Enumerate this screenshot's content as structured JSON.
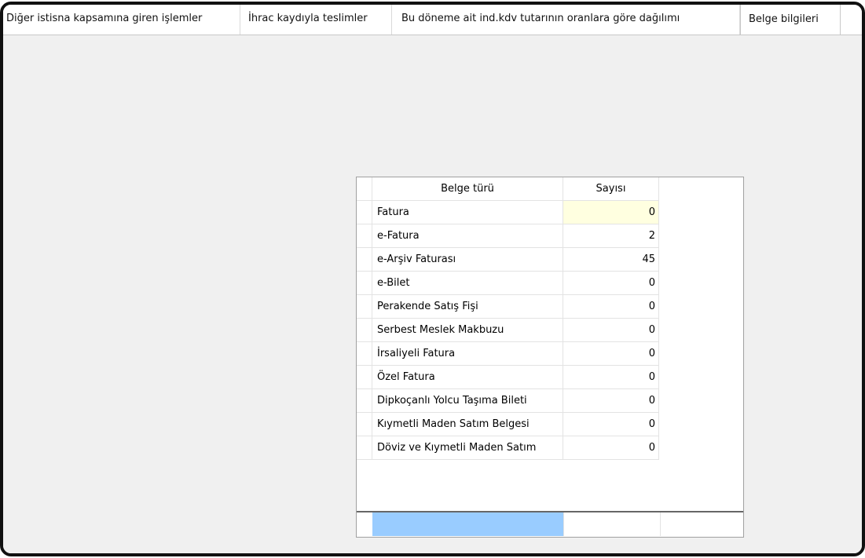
{
  "tabs": [
    {
      "label": "Diğer istisna kapsamına giren işlemler",
      "active": false
    },
    {
      "label": "İhrac kaydıyla teslimler",
      "active": false
    },
    {
      "label": "Bu döneme ait ind.kdv tutarının oranlara göre dağılımı",
      "active": false
    },
    {
      "label": "Belge bilgileri",
      "active": true
    }
  ],
  "table": {
    "headers": [
      "Belge türü",
      "Sayısı"
    ],
    "rows": [
      {
        "type": "Fatura",
        "count": "0"
      },
      {
        "type": "e-Fatura",
        "count": "2"
      },
      {
        "type": "e-Arşiv Faturası",
        "count": "45"
      },
      {
        "type": "e-Bilet",
        "count": "0"
      },
      {
        "type": "Perakende Satış Fişi",
        "count": "0"
      },
      {
        "type": "Serbest Meslek Makbuzu",
        "count": "0"
      },
      {
        "type": "İrsaliyeli Fatura",
        "count": "0"
      },
      {
        "type": "Özel Fatura",
        "count": "0"
      },
      {
        "type": "Dipkoçanlı Yolcu Taşıma Bileti",
        "count": "0"
      },
      {
        "type": "Kıymetli Maden Satım Belgesi",
        "count": "0"
      },
      {
        "type": "Döviz ve Kıymetli Maden Satım",
        "count": "0"
      }
    ]
  },
  "colors": {
    "active_cell": "#ffffe0",
    "footer_selection": "#99ccff",
    "panel_bg": "#f0f0f0"
  }
}
